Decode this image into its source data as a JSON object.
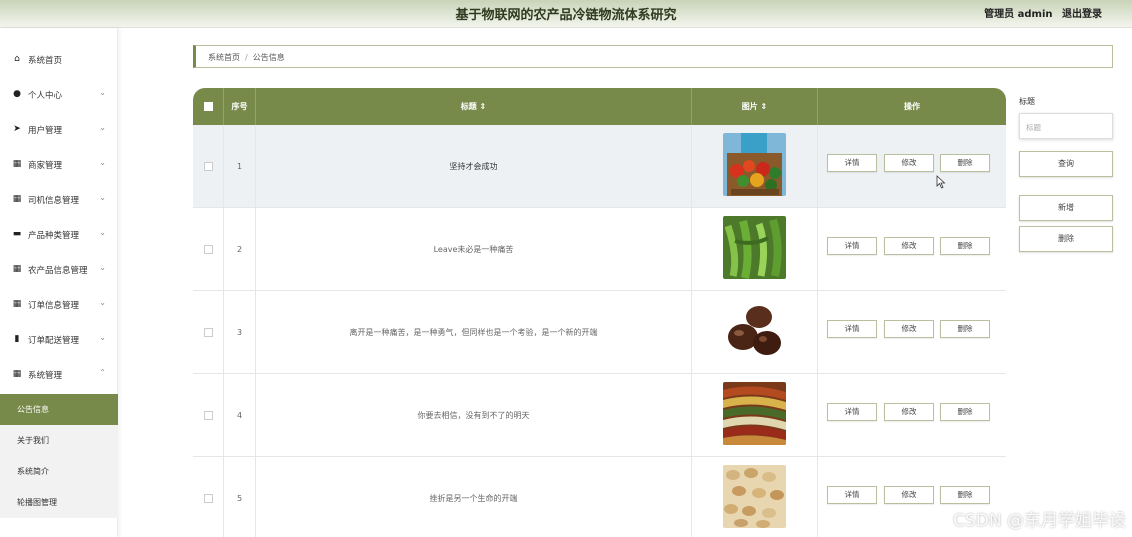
{
  "header": {
    "title": "基于物联网的农产品冷链物流体系研究",
    "user": "管理员 admin",
    "logout": "退出登录"
  },
  "sidebar": {
    "items": [
      {
        "label": "系统首页",
        "icon": "home-icon"
      },
      {
        "label": "个人中心",
        "icon": "user-icon"
      },
      {
        "label": "用户管理",
        "icon": "send-icon"
      },
      {
        "label": "商家管理",
        "icon": "grid-icon"
      },
      {
        "label": "司机信息管理",
        "icon": "grid-icon"
      },
      {
        "label": "产品种类管理",
        "icon": "monitor-icon"
      },
      {
        "label": "农产品信息管理",
        "icon": "grid-icon"
      },
      {
        "label": "订单信息管理",
        "icon": "grid-icon"
      },
      {
        "label": "订单配送管理",
        "icon": "bar-chart-icon"
      },
      {
        "label": "系统管理",
        "icon": "grid-icon"
      }
    ],
    "subitems": [
      "公告信息",
      "关于我们",
      "系统简介",
      "轮播图管理"
    ]
  },
  "breadcrumb": {
    "home": "系统首页",
    "sep": "/",
    "current": "公告信息"
  },
  "table": {
    "headers": {
      "index": "序号",
      "title": "标题 ⇕",
      "image": "图片 ⇕",
      "actions": "操作"
    },
    "rows": [
      {
        "index": "1",
        "title": "坚持才会成功"
      },
      {
        "index": "2",
        "title": "Leave未必是一种痛苦"
      },
      {
        "index": "3",
        "title": "离开是一种痛苦，是一种勇气，但同样也是一个考验，是一个新的开端"
      },
      {
        "index": "4",
        "title": "你要去相信，没有到不了的明天"
      },
      {
        "index": "5",
        "title": "挫折是另一个生命的开端"
      }
    ],
    "actions": {
      "detail": "详情",
      "edit": "修改",
      "delete": "删除"
    }
  },
  "right_panel": {
    "label": "标题",
    "placeholder": "标题",
    "query": "查询",
    "add": "新增",
    "delete": "删除"
  },
  "watermark": "CSDN @东月学姐毕设",
  "colors": {
    "accent": "#778a4a"
  }
}
